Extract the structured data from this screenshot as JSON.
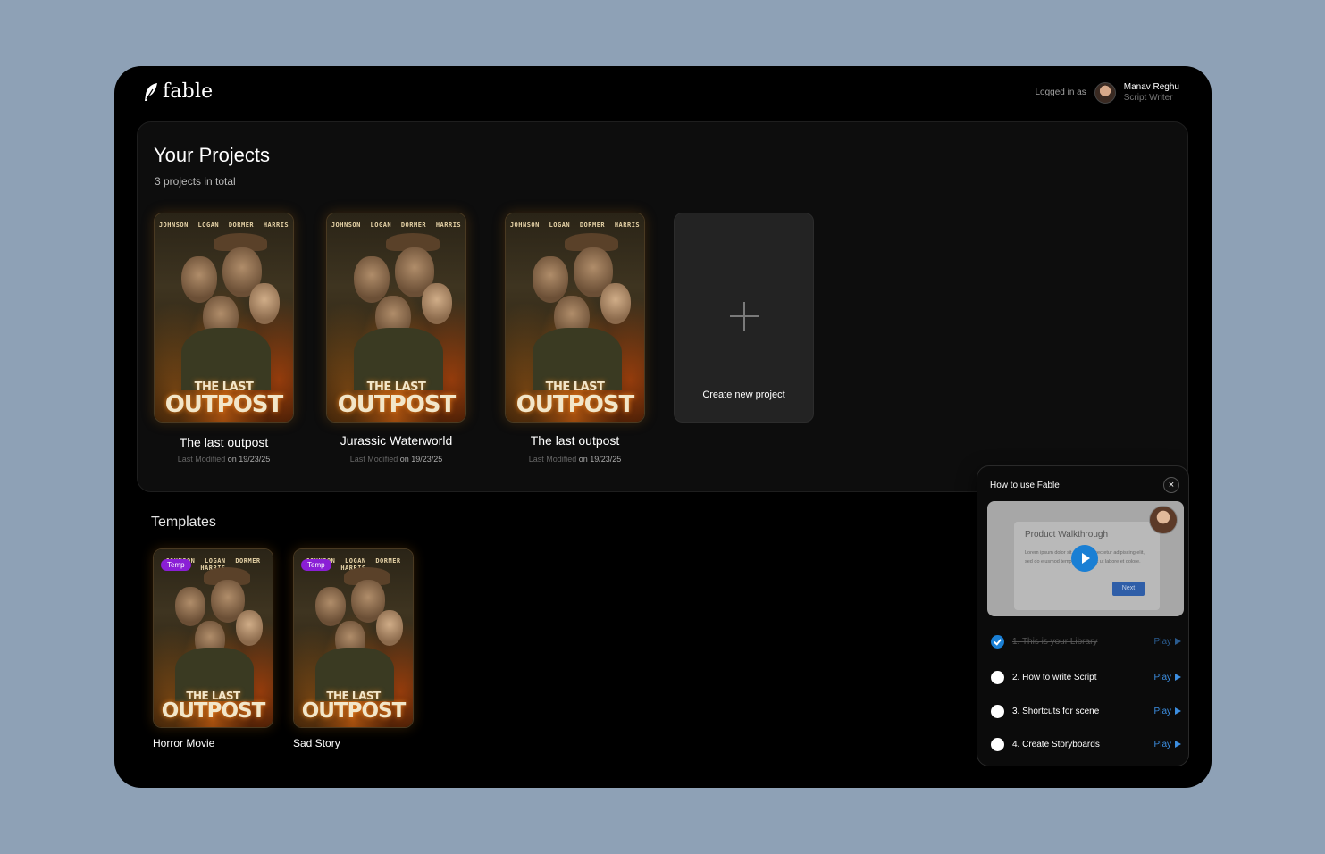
{
  "app": {
    "name": "fable"
  },
  "user": {
    "logged_in_label": "Logged in as",
    "name": "Manav Reghu",
    "role": "Script Writer"
  },
  "projects": {
    "title": "Your Projects",
    "subtitle": "3 projects in total",
    "items": [
      {
        "name": "The last outpost",
        "modified_label": "Last Modified",
        "modified_on": "on 19/23/25"
      },
      {
        "name": "Jurassic Waterworld",
        "modified_label": "Last Modified",
        "modified_on": "on 19/23/25"
      },
      {
        "name": "The last outpost",
        "modified_label": "Last Modified",
        "modified_on": "on 19/23/25"
      }
    ],
    "create_label": "Create new project"
  },
  "poster": {
    "cast": "JOHNSON LOGAN DORMER HARRIS",
    "title_top": "THE LAST",
    "title_bottom": "OUTPOST"
  },
  "templates": {
    "title": "Templates",
    "badge": "Temp",
    "items": [
      {
        "name": "Horror Movie"
      },
      {
        "name": "Sad Story"
      }
    ]
  },
  "help": {
    "title": "How to use Fable",
    "close": "×",
    "video": {
      "title": "Product Walkthrough",
      "text": "Lorem ipsum dolor sit amet, consectetur adipiscing elit, sed do eiusmod tempor incididunt ut labore et dolore.",
      "next": "Next"
    },
    "play_label": "Play",
    "steps": [
      {
        "label": "1. This is your Library",
        "done": true
      },
      {
        "label": "2. How to write Script",
        "done": false
      },
      {
        "label": "3. Shortcuts for scene",
        "done": false
      },
      {
        "label": "4. Create Storyboards",
        "done": false
      }
    ]
  },
  "colors": {
    "background": "#8ea1b6",
    "badge": "#8a1fd6",
    "accent": "#1a7fd4"
  }
}
